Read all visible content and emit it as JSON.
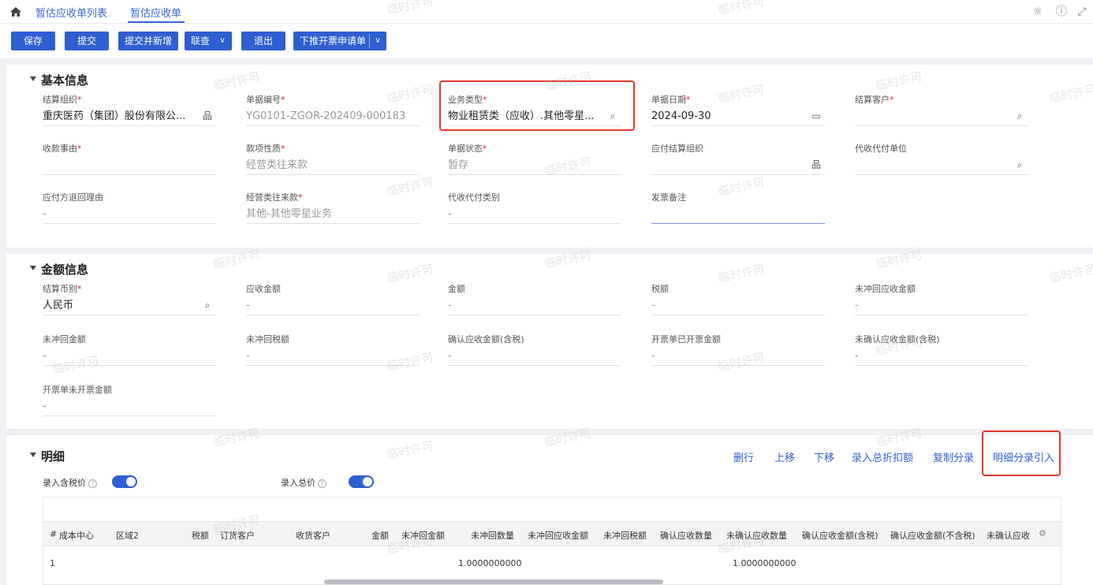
{
  "tabs": {
    "list_label": "暂估应收单列表",
    "current_label": "暂估应收单"
  },
  "toolbar": {
    "save": "保存",
    "submit": "提交",
    "submit_new": "提交并新增",
    "query": "联查",
    "exit": "退出",
    "push_invoice": "下推开票申请单"
  },
  "basic": {
    "title": "基本信息",
    "fields": [
      {
        "label": "结算组织",
        "required": true,
        "value": "重庆医药（集团）股份有限公...",
        "icon": "org"
      },
      {
        "label": "单据编号",
        "required": true,
        "value": "YG0101-ZGOR-202409-000183"
      },
      {
        "label": "业务类型",
        "required": true,
        "value": "物业租赁类（应收）.其他零星...",
        "icon": "search"
      },
      {
        "label": "单据日期",
        "required": true,
        "value": "2024-09-30",
        "icon": "calendar"
      },
      {
        "label": "结算客户",
        "required": true,
        "value": "",
        "icon": "search"
      },
      {
        "label": "收款事由",
        "required": true,
        "value": ""
      },
      {
        "label": "款项性质",
        "required": true,
        "value": "经营类往来款"
      },
      {
        "label": "单据状态",
        "required": true,
        "value": "暂存"
      },
      {
        "label": "应付结算组织",
        "required": false,
        "value": "",
        "icon": "org"
      },
      {
        "label": "代收代付单位",
        "required": false,
        "value": "",
        "icon": "search"
      },
      {
        "label": "应付方退回理由",
        "required": false,
        "value": "-"
      },
      {
        "label": "经营类往来款",
        "required": true,
        "value": "其他-其他零星业务"
      },
      {
        "label": "代收代付类别",
        "required": false,
        "value": "-"
      },
      {
        "label": "发票备注",
        "required": false,
        "value": ""
      }
    ]
  },
  "amount": {
    "title": "金额信息",
    "fields": [
      {
        "label": "结算币别",
        "required": true,
        "value": "人民币",
        "icon": "search"
      },
      {
        "label": "应收金额",
        "value": "-"
      },
      {
        "label": "金额",
        "value": "-"
      },
      {
        "label": "税额",
        "value": "-"
      },
      {
        "label": "未冲回应收金额",
        "value": "-"
      },
      {
        "label": "未冲回金额",
        "value": "-"
      },
      {
        "label": "未冲回税额",
        "value": "-"
      },
      {
        "label": "确认应收金额(含税)",
        "value": "-"
      },
      {
        "label": "开票单已开票金额",
        "value": "-"
      },
      {
        "label": "未确认应收金额(含税)",
        "value": "-"
      },
      {
        "label": "开票单未开票金额",
        "value": "-"
      }
    ]
  },
  "detail": {
    "title": "明细",
    "actions": [
      "删行",
      "上移",
      "下移",
      "录入总折扣额",
      "复制分录",
      "明细分录引入"
    ],
    "toggle_tax_label": "录入含税价",
    "toggle_total_label": "录入总价",
    "columns": [
      "#",
      "成本中心",
      "区域2",
      "税额",
      "订货客户",
      "收货客户",
      "金额",
      "未冲回金额",
      "未冲回数量",
      "未冲回应收金额",
      "未冲回税额",
      "确认应收数量",
      "未确认应收数量",
      "确认应收金额(含税)",
      "确认应收金额(不含税)",
      "未确认应收"
    ],
    "rows": [
      {
        "no": "1",
        "unreversed_qty": "1.0000000000",
        "unconfirmed_qty": "1.0000000000"
      }
    ]
  },
  "watermark": "临时许可",
  "colors": {
    "primary": "#2f5fd0",
    "highlight": "#e0392b"
  }
}
